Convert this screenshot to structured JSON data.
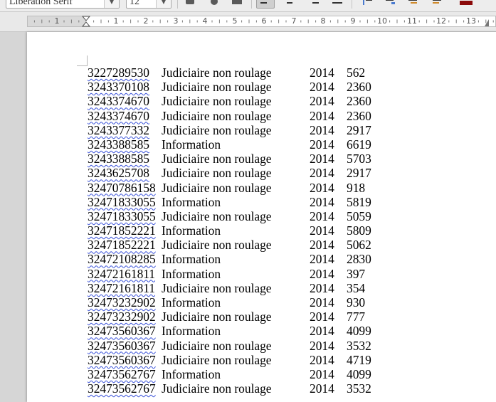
{
  "toolbar": {
    "font_name": "Liberation Serif",
    "font_size": "12"
  },
  "ruler": {
    "labels": [
      "1",
      "1",
      "2",
      "3",
      "4",
      "5",
      "6",
      "7",
      "8",
      "9",
      "10",
      "11",
      "12",
      "13"
    ]
  },
  "document": {
    "rows": [
      {
        "id": "3227289530",
        "type": "Judiciaire non roulage",
        "year": "2014",
        "value": "562"
      },
      {
        "id": "3243370108",
        "type": "Judiciaire non roulage",
        "year": "2014",
        "value": "2360"
      },
      {
        "id": "3243374670",
        "type": "Judiciaire non roulage",
        "year": "2014",
        "value": "2360"
      },
      {
        "id": "3243374670",
        "type": "Judiciaire non roulage",
        "year": "2014",
        "value": "2360"
      },
      {
        "id": "3243377332",
        "type": "Judiciaire non roulage",
        "year": "2014",
        "value": "2917"
      },
      {
        "id": "3243388585",
        "type": "Information",
        "year": "2014",
        "value": "6619"
      },
      {
        "id": "3243388585",
        "type": "Judiciaire non roulage",
        "year": "2014",
        "value": "5703"
      },
      {
        "id": "3243625708",
        "type": "Judiciaire non roulage",
        "year": "2014",
        "value": "2917"
      },
      {
        "id": "32470786158",
        "type": "Judiciaire non roulage",
        "year": "2014",
        "value": "918"
      },
      {
        "id": "32471833055",
        "type": "Information",
        "year": "2014",
        "value": "5819"
      },
      {
        "id": "32471833055",
        "type": "Judiciaire non roulage",
        "year": "2014",
        "value": "5059"
      },
      {
        "id": "32471852221",
        "type": "Information",
        "year": "2014",
        "value": "5809"
      },
      {
        "id": "32471852221",
        "type": "Judiciaire non roulage",
        "year": "2014",
        "value": "5062"
      },
      {
        "id": "32472108285",
        "type": "Information",
        "year": "2014",
        "value": "2830"
      },
      {
        "id": "32472161811",
        "type": "Information",
        "year": "2014",
        "value": "397"
      },
      {
        "id": "32472161811",
        "type": "Judiciaire non roulage",
        "year": "2014",
        "value": "354"
      },
      {
        "id": "32473232902",
        "type": "Information",
        "year": "2014",
        "value": "930"
      },
      {
        "id": "32473232902",
        "type": "Judiciaire non roulage",
        "year": "2014",
        "value": "777"
      },
      {
        "id": "32473560367",
        "type": "Information",
        "year": "2014",
        "value": "4099"
      },
      {
        "id": "32473560367",
        "type": "Judiciaire non roulage",
        "year": "2014",
        "value": "3532"
      },
      {
        "id": "32473560367",
        "type": "Judiciaire non roulage",
        "year": "2014",
        "value": "4719"
      },
      {
        "id": "32473562767",
        "type": "Information",
        "year": "2014",
        "value": "4099"
      },
      {
        "id": "32473562767",
        "type": "Judiciaire non roulage",
        "year": "2014",
        "value": "3532"
      }
    ]
  }
}
